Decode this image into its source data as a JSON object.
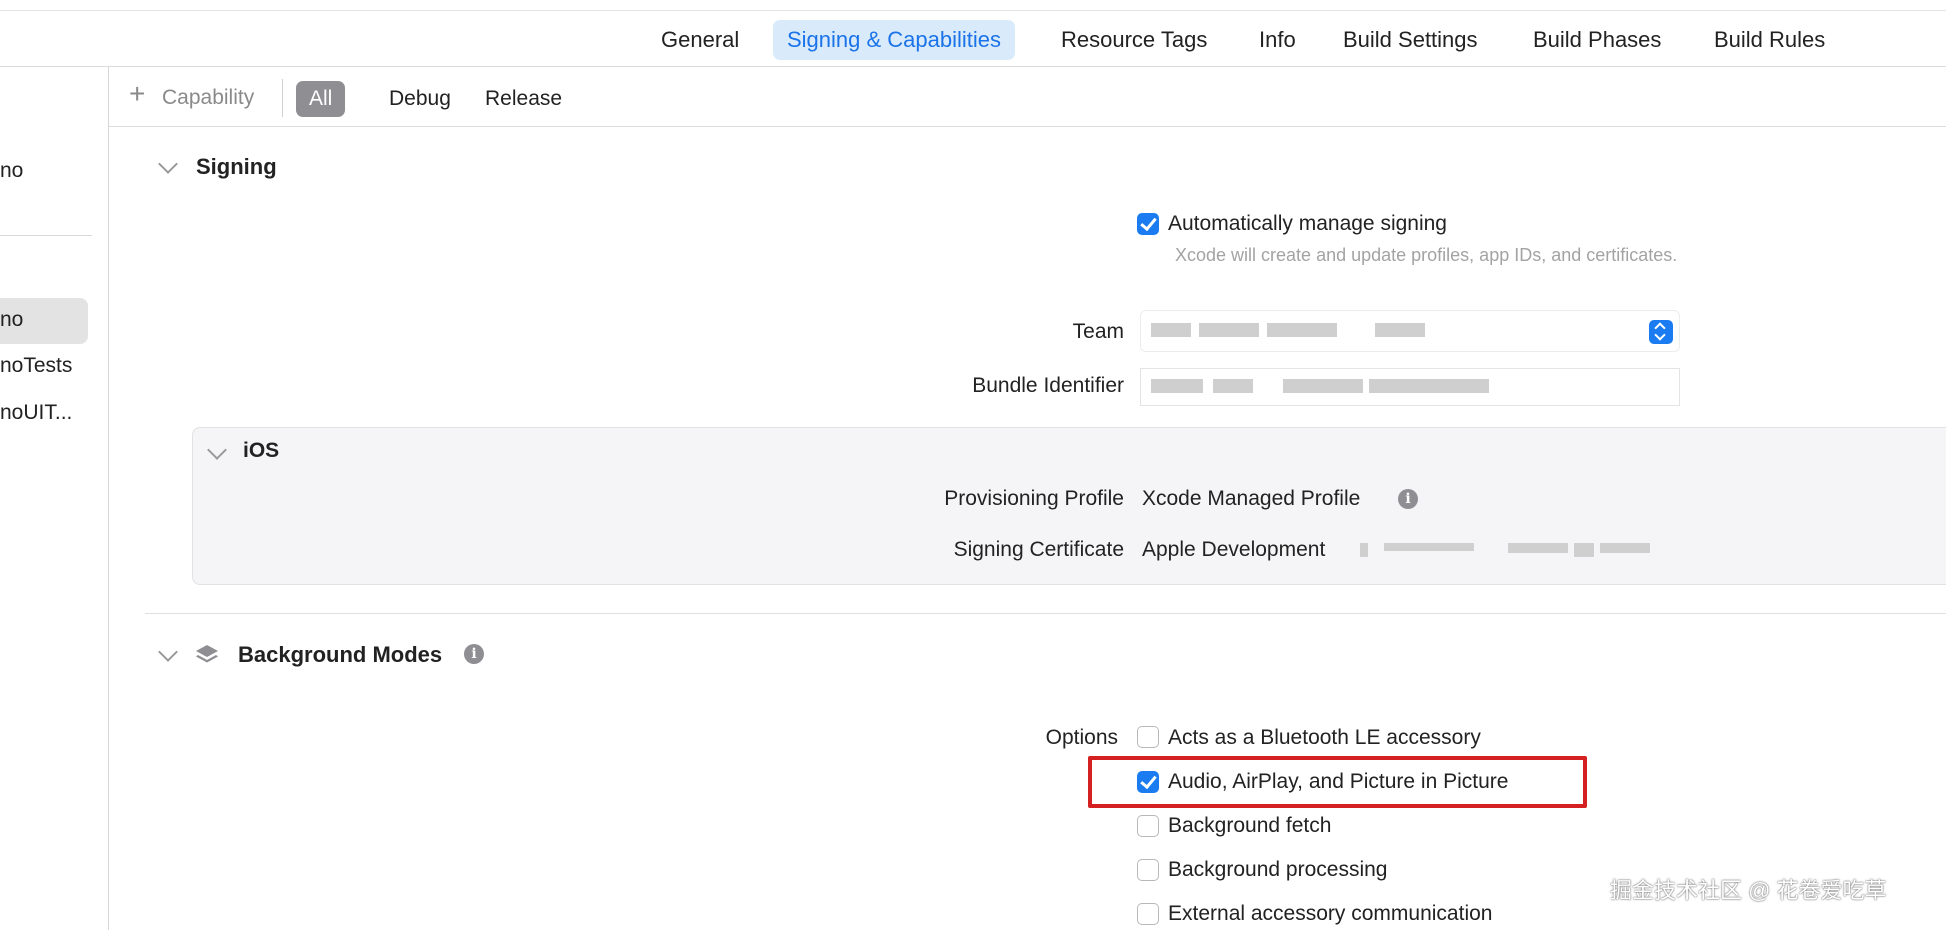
{
  "tabs": [
    {
      "label": "General",
      "active": false
    },
    {
      "label": "Signing & Capabilities",
      "active": true
    },
    {
      "label": "Resource Tags",
      "active": false
    },
    {
      "label": "Info",
      "active": false
    },
    {
      "label": "Build Settings",
      "active": false
    },
    {
      "label": "Build Phases",
      "active": false
    },
    {
      "label": "Build Rules",
      "active": false
    }
  ],
  "sidebar": {
    "items": [
      "no",
      "no",
      "noTests",
      "noUIT..."
    ],
    "selected_index": 1
  },
  "filterbar": {
    "capability_label": "Capability",
    "filters": [
      {
        "label": "All",
        "active": true
      },
      {
        "label": "Debug",
        "active": false
      },
      {
        "label": "Release",
        "active": false
      }
    ]
  },
  "signing": {
    "title": "Signing",
    "auto_manage_label": "Automatically manage signing",
    "auto_manage_checked": true,
    "auto_manage_hint": "Xcode will create and update profiles, app IDs, and certificates.",
    "team_label": "Team",
    "bundle_label": "Bundle Identifier",
    "ios": {
      "title": "iOS",
      "profile_label": "Provisioning Profile",
      "profile_value": "Xcode Managed Profile",
      "certificate_label": "Signing Certificate",
      "certificate_value": "Apple Development"
    }
  },
  "background_modes": {
    "title": "Background Modes",
    "options_label": "Options",
    "options": [
      {
        "label": "Acts as a Bluetooth LE accessory",
        "checked": false
      },
      {
        "label": "Audio, AirPlay, and Picture in Picture",
        "checked": true
      },
      {
        "label": "Background fetch",
        "checked": false
      },
      {
        "label": "Background processing",
        "checked": false
      },
      {
        "label": "External accessory communication",
        "checked": false
      }
    ]
  },
  "watermark": "掘金技术社区 @ 花卷爱吃草",
  "colors": {
    "accent": "#1a7cf0",
    "tab_active_bg": "#d9ebfb",
    "highlight": "#d42020"
  }
}
